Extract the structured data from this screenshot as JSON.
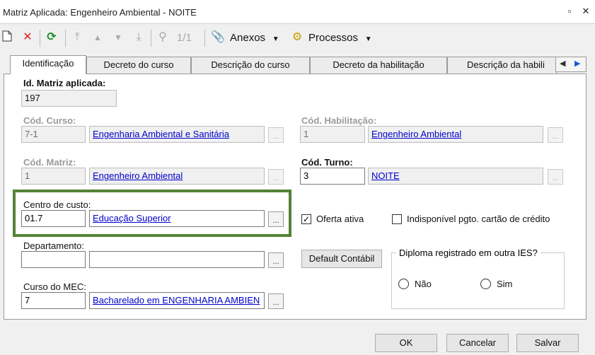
{
  "window": {
    "title": "Matriz Aplicada: Engenheiro Ambiental - NOITE"
  },
  "toolbar": {
    "record_counter": "1/1",
    "anexos_label": "Anexos",
    "processos_label": "Processos"
  },
  "tabs": [
    {
      "label": "Identificação",
      "active": true
    },
    {
      "label": "Decreto do curso",
      "active": false
    },
    {
      "label": "Descrição do curso",
      "active": false
    },
    {
      "label": "Decreto da habilitação",
      "active": false
    },
    {
      "label": "Descrição da habili",
      "active": false
    }
  ],
  "form": {
    "id_matriz": {
      "label": "Id. Matriz aplicada:",
      "value": "197"
    },
    "cod_curso": {
      "label": "Cód. Curso:",
      "code": "7-1",
      "name": "Engenharia Ambiental e Sanitária"
    },
    "cod_habilitacao": {
      "label": "Cód. Habilitação:",
      "code": "1",
      "name": "Engenheiro Ambiental"
    },
    "cod_matriz": {
      "label": "Cód. Matriz:",
      "code": "1",
      "name": "Engenheiro Ambiental"
    },
    "cod_turno": {
      "label": "Cód. Turno:",
      "code": "3",
      "name": "NOITE"
    },
    "centro_custo": {
      "label": "Centro de custo:",
      "code": "01.7",
      "name": "Educação Superior"
    },
    "departamento": {
      "label": "Departamento:",
      "code": "",
      "name": ""
    },
    "curso_mec": {
      "label": "Curso do MEC:",
      "code": "7",
      "name": "Bacharelado em ENGENHARIA AMBIEN"
    },
    "oferta_ativa": {
      "label": "Oferta ativa",
      "checked": true
    },
    "indisponivel": {
      "label": "Indisponível pgto. cartão de crédito",
      "checked": false
    },
    "default_contabil_label": "Default Contábil",
    "diploma": {
      "legend": "Diploma registrado em outra IES?",
      "options": [
        "Não",
        "Sim"
      ]
    },
    "ellipsis": "..."
  },
  "footer": {
    "ok_label": "OK",
    "cancel_label": "Cancelar",
    "save_label": "Salvar"
  },
  "colors": {
    "highlight": "#548235",
    "link": "#0000cc"
  }
}
